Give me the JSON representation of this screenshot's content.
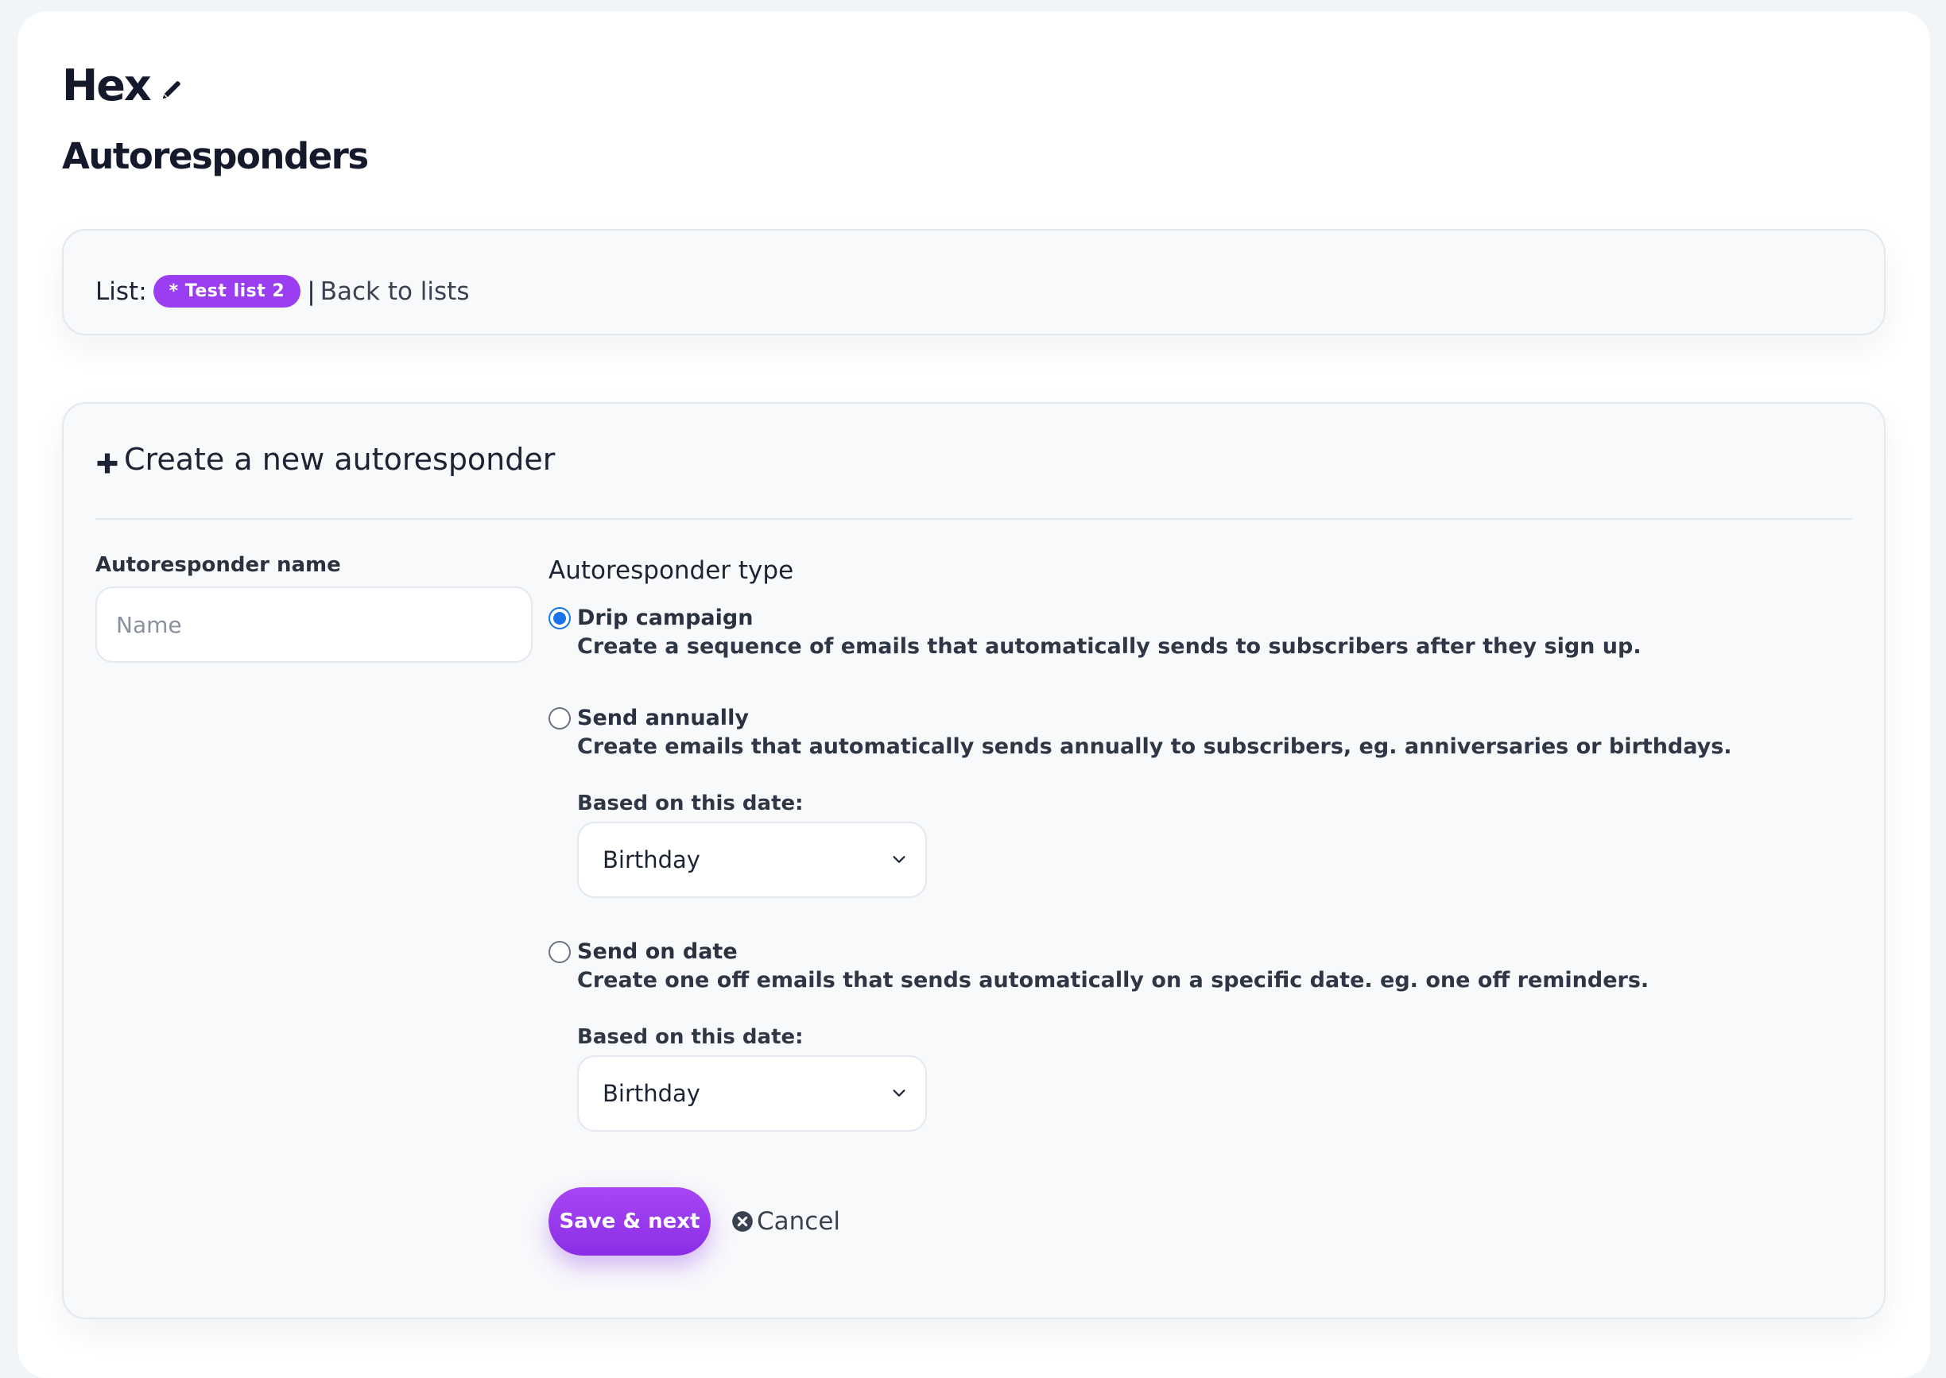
{
  "header": {
    "brand": "Hex",
    "title": "Autoresponders"
  },
  "list_bar": {
    "label": "List:",
    "list_name": "* Test list 2",
    "separator": "|",
    "back_link": "Back to lists"
  },
  "form": {
    "heading": "Create a new autoresponder",
    "name_label": "Autoresponder name",
    "name_placeholder": "Name",
    "name_value": "",
    "type_label": "Autoresponder type",
    "options": [
      {
        "title": "Drip campaign",
        "description": "Create a sequence of emails that automatically sends to subscribers after they sign up.",
        "checked": true
      },
      {
        "title": "Send annually",
        "description": "Create emails that automatically sends annually to subscribers, eg. anniversaries or birthdays.",
        "date_label": "Based on this date:",
        "date_value": "Birthday",
        "checked": false
      },
      {
        "title": "Send on date",
        "description": "Create one off emails that sends automatically on a specific date. eg. one off reminders.",
        "date_label": "Based on this date:",
        "date_value": "Birthday",
        "checked": false
      }
    ],
    "save_label": "Save & next",
    "cancel_label": "Cancel"
  },
  "colors": {
    "accent": "#9b3ef1",
    "radio_checked": "#1a73e8"
  },
  "icons": [
    "pencil-icon",
    "plus-icon",
    "chevron-down-icon",
    "close-circle-icon"
  ]
}
